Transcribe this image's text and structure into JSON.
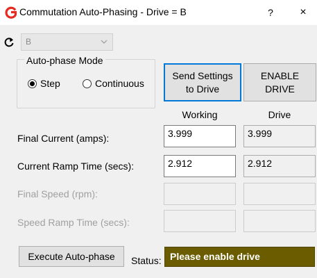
{
  "window": {
    "title": "Commutation Auto-Phasing - Drive = B",
    "help_label": "?",
    "close_label": "×"
  },
  "drive_select": {
    "value": "B"
  },
  "mode": {
    "legend": "Auto-phase Mode",
    "options": [
      {
        "label": "Step",
        "checked": true
      },
      {
        "label": "Continuous",
        "checked": false
      }
    ]
  },
  "buttons": {
    "send_settings_line1": "Send Settings",
    "send_settings_line2": "to Drive",
    "enable_drive_line1": "ENABLE",
    "enable_drive_line2": "DRIVE",
    "execute": "Execute Auto-phase"
  },
  "columns": {
    "working": "Working",
    "drive": "Drive"
  },
  "rows": {
    "final_current": {
      "label": "Final Current (amps):",
      "working": "3.999",
      "drive": "3.999"
    },
    "current_ramp": {
      "label": "Current Ramp Time (secs):",
      "working": "2.912",
      "drive": "2.912"
    },
    "final_speed": {
      "label": "Final Speed (rpm):",
      "working": "",
      "drive": ""
    },
    "speed_ramp": {
      "label": "Speed Ramp Time (secs):",
      "working": "",
      "drive": ""
    }
  },
  "status": {
    "label": "Status:",
    "text": "Please enable drive",
    "color": "#6b5c00"
  },
  "colors": {
    "accent": "#0078d7",
    "title_icon": "#e52b20"
  }
}
